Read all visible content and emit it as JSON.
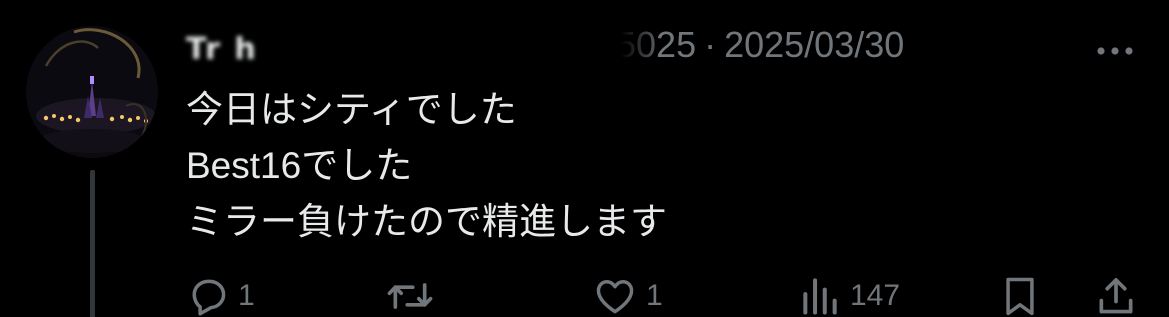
{
  "tweet": {
    "author": {
      "display_name": "Tr h",
      "handle_tail": "5025",
      "separator": "·",
      "date": "2025/03/30"
    },
    "more_icon": "more-dots-icon",
    "lines": [
      "今日はシティでした",
      "Best16でした",
      "ミラー負けたので精進します"
    ],
    "actions": {
      "reply": {
        "icon": "reply-icon",
        "count": "1"
      },
      "retweet": {
        "icon": "retweet-icon",
        "count": ""
      },
      "like": {
        "icon": "heart-icon",
        "count": "1"
      },
      "views": {
        "icon": "views-chart-icon",
        "count": "147"
      },
      "bookmark": {
        "icon": "bookmark-icon"
      },
      "share": {
        "icon": "share-icon"
      }
    },
    "colors": {
      "background": "#000000",
      "text_primary": "#e7e9ea",
      "text_secondary": "#71767b",
      "thread_line": "#333639"
    }
  }
}
